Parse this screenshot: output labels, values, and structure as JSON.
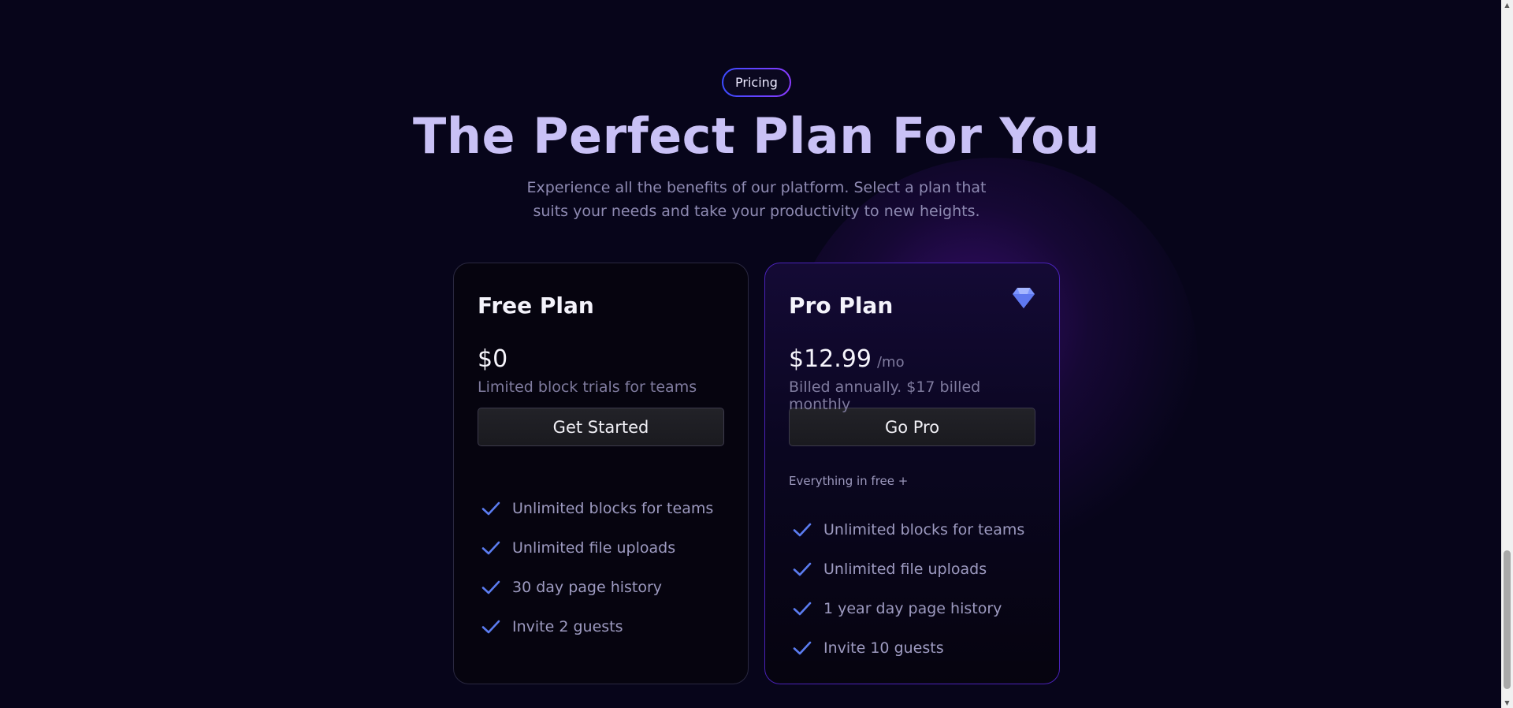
{
  "badge": {
    "label": "Pricing"
  },
  "heading": {
    "title": "The Perfect Plan For You",
    "subtitle": "Experience all the benefits of our platform. Select a plan that suits your needs and take your productivity to new heights."
  },
  "plans": [
    {
      "name": "Free Plan",
      "price": "$0",
      "period": "",
      "note": "Limited block trials for teams",
      "cta": "Get Started",
      "extra": "",
      "features": [
        "Unlimited blocks for teams",
        "Unlimited file uploads",
        "30 day page history",
        "Invite 2 guests"
      ]
    },
    {
      "name": "Pro Plan",
      "price": "$12.99",
      "period": "/mo",
      "note": "Billed annually. $17 billed monthly",
      "cta": "Go Pro",
      "extra": "Everything in free +",
      "icon": "diamond-icon",
      "features": [
        "Unlimited blocks for teams",
        "Unlimited file uploads",
        "1 year day page history",
        "Invite 10 guests"
      ]
    }
  ],
  "colors": {
    "background": "#07051a",
    "title": "#c9c1f6",
    "accent_check": "#5b7cf0",
    "pro_border": "#4a22b8",
    "gem": "#7c95ff"
  }
}
